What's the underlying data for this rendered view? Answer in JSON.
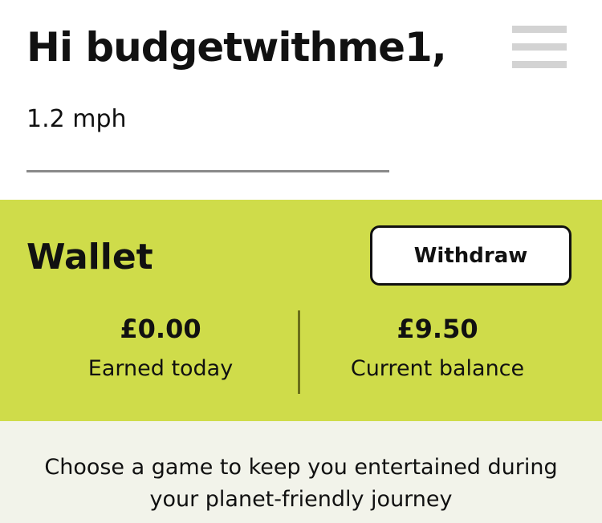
{
  "header": {
    "greeting": "Hi budgetwithme1,",
    "speed": "1.2 mph",
    "menu_icon": "hamburger-menu-icon"
  },
  "wallet": {
    "title": "Wallet",
    "withdraw_label": "Withdraw",
    "earned_today": {
      "value": "£0.00",
      "label": "Earned today"
    },
    "current_balance": {
      "value": "£9.50",
      "label": "Current balance"
    },
    "colors": {
      "background": "#cfdc4a"
    }
  },
  "games": {
    "intro_text": "Choose a game to keep you entertained during your planet-friendly journey"
  }
}
